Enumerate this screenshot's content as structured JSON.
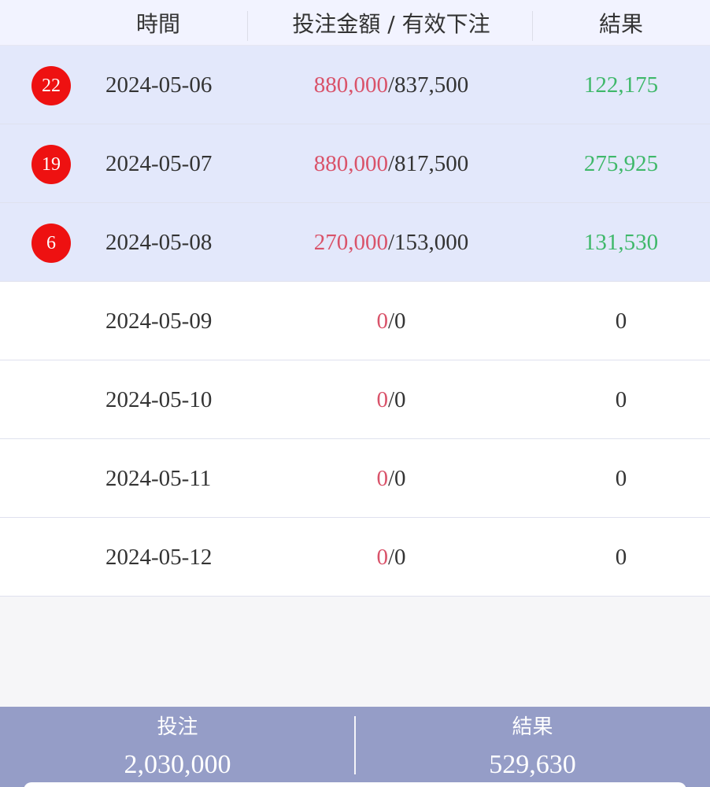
{
  "header": {
    "col_time": "時間",
    "col_bet": "投注金額 / 有效下注",
    "col_result": "結果"
  },
  "rows": [
    {
      "badge": "22",
      "date": "2024-05-06",
      "bet_amount": "880,000",
      "valid_bet": "/837,500",
      "result": "122,175"
    },
    {
      "badge": "19",
      "date": "2024-05-07",
      "bet_amount": "880,000",
      "valid_bet": "/817,500",
      "result": "275,925"
    },
    {
      "badge": "6",
      "date": "2024-05-08",
      "bet_amount": "270,000",
      "valid_bet": "/153,000",
      "result": "131,530"
    },
    {
      "badge": "",
      "date": "2024-05-09",
      "bet_amount": "0",
      "valid_bet": "/0",
      "result": "0"
    },
    {
      "badge": "",
      "date": "2024-05-10",
      "bet_amount": "0",
      "valid_bet": "/0",
      "result": "0"
    },
    {
      "badge": "",
      "date": "2024-05-11",
      "bet_amount": "0",
      "valid_bet": "/0",
      "result": "0"
    },
    {
      "badge": "",
      "date": "2024-05-12",
      "bet_amount": "0",
      "valid_bet": "/0",
      "result": "0"
    }
  ],
  "summary": {
    "bet_label": "投注",
    "bet_value": "2,030,000",
    "result_label": "結果",
    "result_value": "529,630"
  },
  "colors": {
    "badge": "#ee1111",
    "bet_amount": "#d9536a",
    "positive_result": "#3fb86a",
    "highlight_row": "#e3e8fb",
    "summary_bar": "#959dc7"
  }
}
